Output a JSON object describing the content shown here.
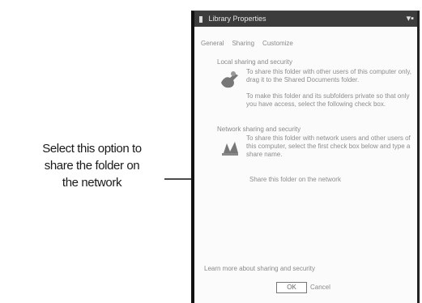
{
  "callout": {
    "lines": [
      "Select this option to",
      "share the folder on",
      "the network"
    ]
  },
  "dialog": {
    "title": "Library Properties",
    "tabs": [
      "General",
      "Sharing",
      "Customize"
    ],
    "local_group_label": "Local sharing and security",
    "local_text_1": "To share this folder with other users of this computer only, drag it to the Shared Documents folder.",
    "local_text_2": "To make this folder and its subfolders private so that only you have access, select the following check box.",
    "network_group_label": "Network sharing and security",
    "network_text_1": "To share this folder with network users and other users of this computer, select the first check box below and type a share name.",
    "network_option": "Share this folder on the network",
    "bottom_label": "Learn more about sharing and security",
    "field_value": "OK",
    "field_label": "Cancel"
  },
  "icons": {
    "title": "folder-icon",
    "local": "hand-share-icon",
    "network": "network-share-icon"
  }
}
